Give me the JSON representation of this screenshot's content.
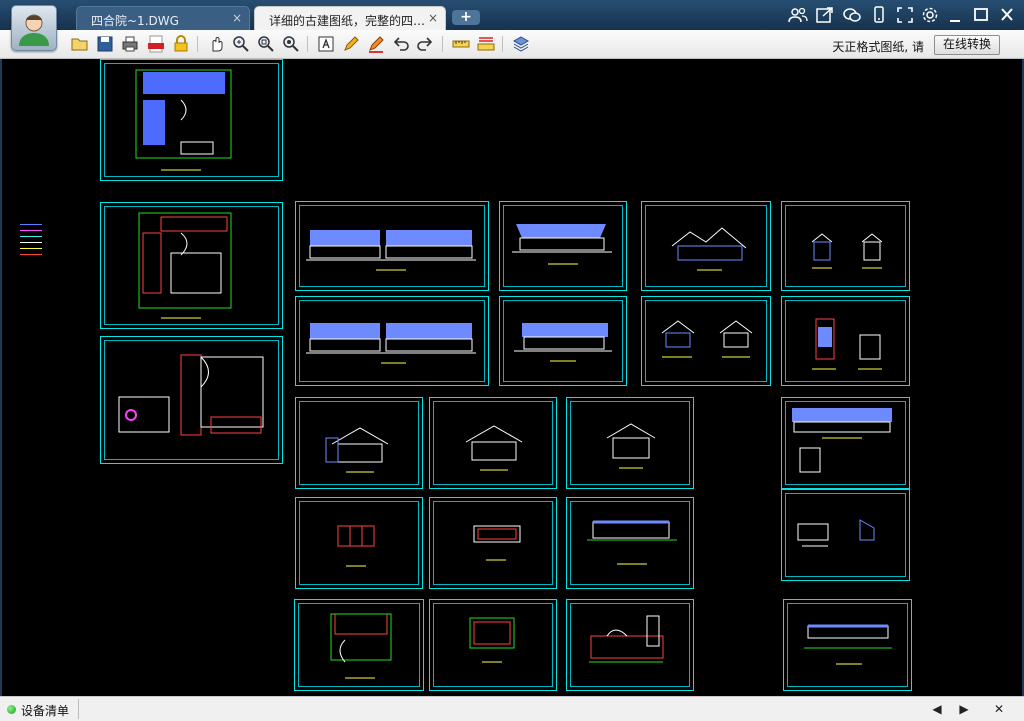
{
  "window": {
    "tabs": [
      {
        "label": "四合院~1.DWG",
        "active": false
      },
      {
        "label": "详细的古建图纸，完整的四…",
        "active": true
      }
    ],
    "add_tab_label": "+",
    "tab_close_glyph": "×"
  },
  "toolbar": {
    "icons": [
      "open-folder-icon",
      "save-icon",
      "print-icon",
      "pdf-icon",
      "lock-icon",
      "pan-icon",
      "zoom-in-icon",
      "zoom-window-icon",
      "zoom-extents-icon",
      "text-icon",
      "pencil-icon",
      "highlighter-icon",
      "undo-icon",
      "redo-icon",
      "measure-icon",
      "measure-area-icon",
      "layers-icon"
    ],
    "convert_text": "天正格式图纸, 请",
    "convert_button": "在线转换"
  },
  "canvas": {
    "background": "#000000",
    "frame_color": "#00e5e5",
    "legend_colors": [
      "#5b7cff",
      "#ff4bff",
      "#3cf0f0",
      "#ffffff",
      "#ffff40",
      "#ff4040"
    ]
  },
  "statusbar": {
    "label": "设备清单",
    "prev_glyph": "◀",
    "next_glyph": "▶",
    "close_glyph": "✕"
  },
  "colors": {
    "title_bg": "#1f4466",
    "accent": "#00e5e5"
  }
}
